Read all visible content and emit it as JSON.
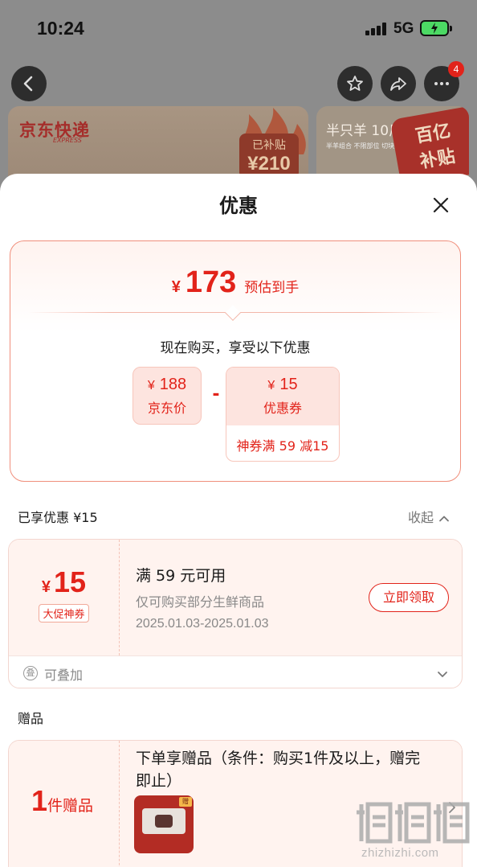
{
  "status_bar": {
    "time": "10:24",
    "network": "5G"
  },
  "nav": {
    "notification_count": "4"
  },
  "background": {
    "banner_left": {
      "brand": "京东快递",
      "brand_sub": "EXPRESS",
      "subsidy_label": "已补贴",
      "subsidy_amount": "¥210"
    },
    "banner_right": {
      "title": "半只羊 10斤",
      "small_text": "半羊组合 不限部位 切块发货",
      "badge_line1": "百亿",
      "badge_line2": "补贴"
    }
  },
  "sheet": {
    "title": "优惠",
    "summary": {
      "currency": "¥",
      "estimated_price": "173",
      "estimated_label": "预估到手",
      "explanation": "现在购买，享受以下优惠",
      "jd_price_currency": "¥",
      "jd_price_value": "188",
      "jd_price_label": "京东价",
      "minus_sign": "-",
      "coupon_currency": "¥",
      "coupon_value": "15",
      "coupon_label": "优惠券",
      "coupon_rule": "神券满 59 减15"
    },
    "enjoyed": {
      "title": "已享优惠 ¥15",
      "collapse_label": "收起"
    },
    "coupon_card": {
      "currency": "¥",
      "amount": "15",
      "tag": "大促神券",
      "condition": "满 59 元可用",
      "scope": "仅可购买部分生鲜商品",
      "validity": "2025.01.03-2025.01.03",
      "claim_button": "立即领取",
      "stackable_icon": "叠",
      "stackable_label": "可叠加"
    },
    "gift": {
      "section_title": "赠品",
      "count": "1",
      "count_unit": "件赠品",
      "condition": "下单享赠品（条件：购买1件及以上，赠完即止）",
      "thumb_badge": "赠"
    }
  },
  "watermark": {
    "text": "zhizhizhi.com"
  },
  "icons": {
    "back": "back-arrow-icon",
    "favorite": "star-icon",
    "share": "share-icon",
    "more": "more-icon",
    "close": "close-icon",
    "collapse": "chevron-up-icon",
    "expand": "chevron-down-icon",
    "gift_detail": "chevron-right-icon",
    "stackable": "stack-icon"
  },
  "colors": {
    "accent": "#e2231a",
    "accent_light": "#fde4df",
    "border_soft": "#f3d6cf"
  }
}
